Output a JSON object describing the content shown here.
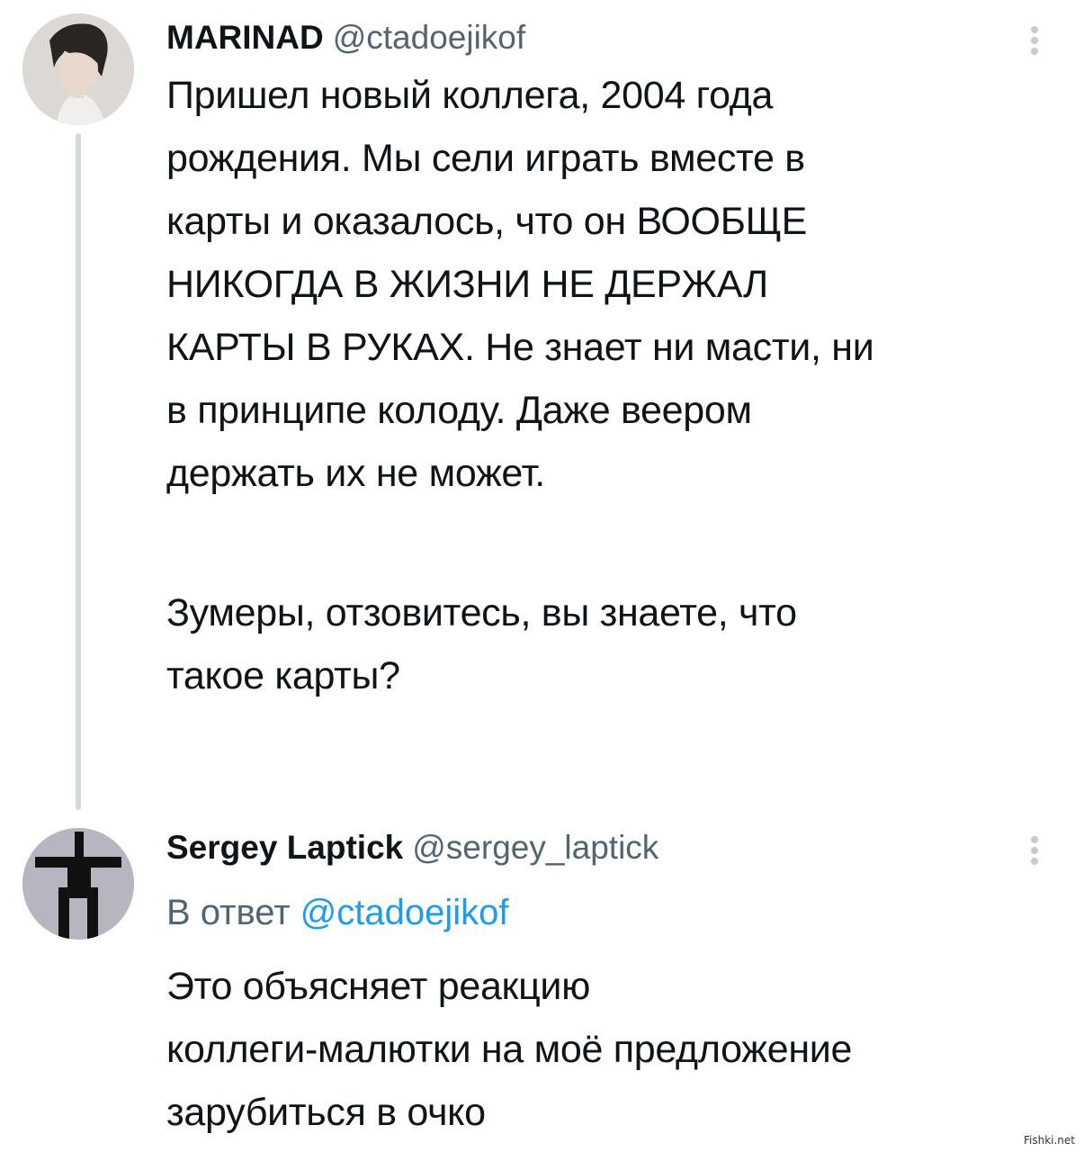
{
  "tweet1": {
    "name": "MARINAD",
    "handle": "@ctadoejikof",
    "text_p1_lines": [
      "Пришел новый коллега, 2004 года",
      "рождения. Мы сели играть вместе в",
      "карты и оказалось, что он ВООБЩЕ",
      "НИКОГДА В ЖИЗНИ НЕ ДЕРЖАЛ",
      "КАРТЫ В РУКАХ. Не знает ни масти, ни",
      "в принципе колоду. Даже веером",
      "держать их не может."
    ],
    "text_p2_lines": [
      "Зумеры, отзовитесь, вы знаете, что",
      "такое карты?"
    ]
  },
  "tweet2": {
    "name": "Sergey Laptick",
    "handle": "@sergey_laptick",
    "reply_prefix": "В ответ",
    "reply_handle": "@ctadoejikof",
    "text_lines": [
      "Это объясняет реакцию",
      "коллеги-малютки на моё предложение",
      "зарубиться в очко"
    ]
  },
  "watermark": "Fishki.net",
  "colors": {
    "text": "#0f1419",
    "muted": "#536471",
    "link": "#1d9bf0",
    "thread_line": "#cfd9de"
  },
  "icons": {
    "more": "more-icon",
    "avatar1": "avatar",
    "avatar2": "avatar"
  }
}
